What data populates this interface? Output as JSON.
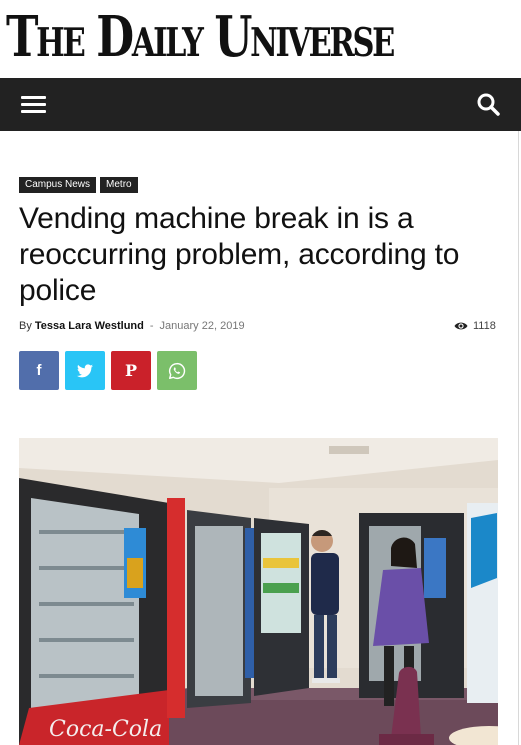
{
  "site": {
    "logo_text": "The Daily Universe"
  },
  "nav": {
    "menu_icon": "hamburger-menu-icon",
    "search_icon": "search-icon"
  },
  "article": {
    "categories": [
      "Campus News",
      "Metro"
    ],
    "title": "Vending machine break in is a reoccurring problem, according to police",
    "by_label": "By",
    "author": "Tessa Lara Westlund",
    "separator": "-",
    "date": "January 22, 2019",
    "views": "1118"
  },
  "share": {
    "facebook_glyph": "f",
    "pinterest_glyph": "P"
  },
  "colors": {
    "nav_background": "#222222",
    "facebook": "#516eab",
    "twitter": "#29c5f6",
    "pinterest": "#ca212a",
    "whatsapp": "#7bbf6a"
  },
  "photo": {
    "alt": ""
  }
}
